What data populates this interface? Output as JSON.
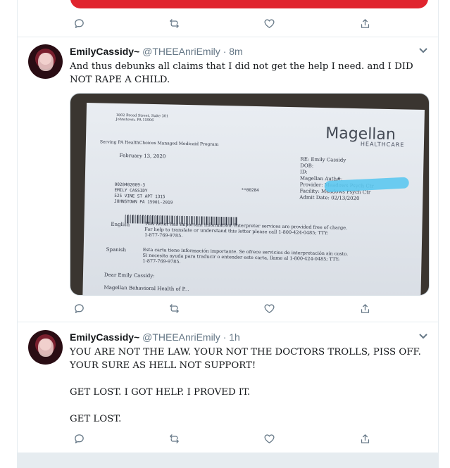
{
  "previous_tweet": {
    "accent_color": "#e0242e"
  },
  "tweets": [
    {
      "name": "EmilyCassidy~",
      "handle": "@THEEAnriEmily",
      "time": "· 8m",
      "text": "And thus debunks all claims that I did not get the help I need. and I DID NOT RAPE A CHILD.",
      "media": {
        "brand": "Magellan",
        "brand_sub": "HEALTHCARE",
        "address": "1802 Broad Street, Suite 301\nJohnstown, PA 15906",
        "program": "Serving PA HealthChoices Managed Medicaid Program",
        "date": "February 13, 2020",
        "re_block": "RE: Emily Cassidy\nDOB:\nID:\nMagellan Auth#:\nProvider: Meadows Psych Ctr\nFacility: Meadows Psych Ctr\nAdmit Date: 02/13/2020",
        "recipient": "0028402009-3\nEMILY CASSIDY\n525 VINE ST APT 1315\nJOHNSTOWN PA 15901-2019",
        "ref": "**00284",
        "english_label": "English",
        "english_text": "This letter has important information. Interpreter services are provided free of charge.\nFor help to translate or understand this letter please call 1-800-424-0485; TTY:\n1-877-769-9785.",
        "spanish_label": "Spanish",
        "spanish_text": "Esta carta tiene información importante. Se ofrece servicios de interpretación sin costo.\nSi necesita ayuda para traducir o entender este carta, llame al 1-800-424-0485; TTY:\n1-877-769-9785.",
        "salutation": "Dear Emily Cassidy:",
        "body_start": "Magellan Behavioral Health of P..."
      }
    },
    {
      "name": "EmilyCassidy~",
      "handle": "@THEEAnriEmily",
      "time": "· 1h",
      "text": "YOU ARE NOT THE LAW. YOUR NOT THE DOCTORS TROLLS, PISS OFF. YOUR SURE AS HELL NOT SUPPORT!\n\nGET LOST. I GOT HELP. I PROVED IT.\n\nGET LOST."
    }
  ],
  "icons": [
    "reply-icon",
    "retweet-icon",
    "like-icon",
    "share-icon",
    "chevron-down-icon"
  ]
}
